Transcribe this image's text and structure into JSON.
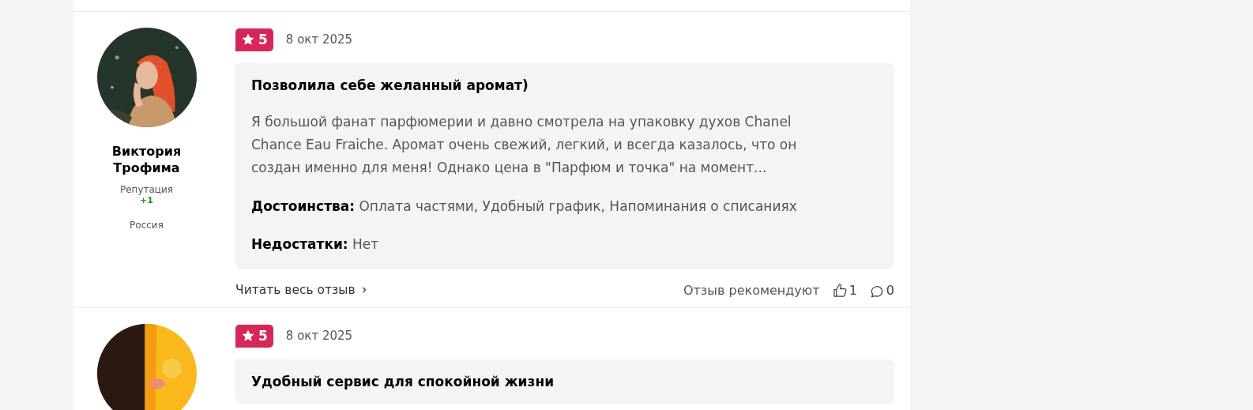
{
  "reviews": [
    {
      "author": {
        "name": "Виктория Трофима",
        "reputation_label": "Репутация",
        "reputation": "+1",
        "country": "Россия"
      },
      "rating": "5",
      "date": "8 окт 2025",
      "title": "Позволила себе желанный аромат)",
      "text": "Я большой фанат парфюмерии и давно смотрела на упаковку духов Chanel Chance Eau Fraiche. Аромат очень свежий, легкий, и всегда казалось, что он создан именно для меня! Однако цена в \"Парфюм и точка\" на момент...",
      "pros_label": "Достоинства:",
      "pros": "Оплата частями, Удобный график, Напоминания о списаниях",
      "cons_label": "Недостатки:",
      "cons": "Нет",
      "read_more": "Читать весь отзыв",
      "recommend_label": "Отзыв рекомендуют",
      "likes": "1",
      "comments": "0"
    },
    {
      "rating": "5",
      "date": "8 окт 2025",
      "title": "Удобный сервис для спокойной жизни"
    }
  ]
}
